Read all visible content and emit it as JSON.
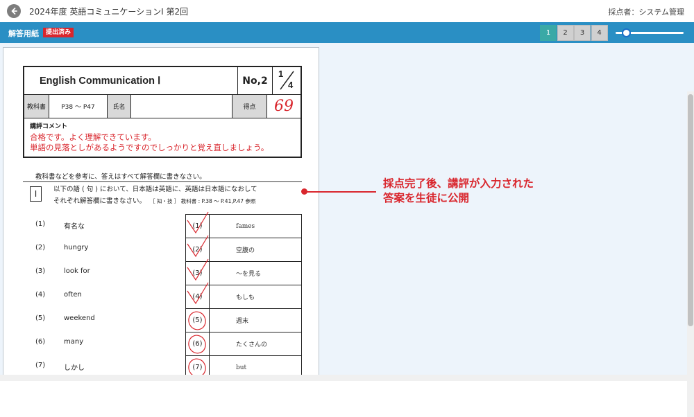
{
  "header": {
    "title": "2024年度 英語コミュニケーションⅠ 第2回",
    "grader": "採点者：システム管理"
  },
  "toolbar": {
    "sheet_label": "解答用紙",
    "status_badge": "提出済み",
    "pages": [
      "1",
      "2",
      "3",
      "4"
    ],
    "active_page": "1",
    "zoom_level": 0.15
  },
  "paper": {
    "course_name": "English Communication Ⅰ",
    "number": "No,2",
    "fraction_num": "1",
    "fraction_den": "4",
    "textbook_label": "教科書",
    "textbook_range": "P38 ～ P47",
    "name_label": "氏名",
    "name_value": "",
    "score_label": "得点",
    "score_value": "69",
    "comment_label": "講評コメント",
    "comment_lines": [
      "合格です。よく理解できています。",
      "単語の見落としがあるようですのでしっかりと覚え直しましょう。"
    ],
    "instruction": "教科書などを参考に、答えはすべて解答欄に書きなさい。",
    "section_number": "Ⅰ",
    "question_line1": "以下の語 ( 句 ) において、日本語は英語に、英語は日本語になおして",
    "question_line2": "それぞれ解答欄に書きなさい。",
    "question_ref": "［ 知・技 ］ 教科書 : P.38 ～ P.41,P.47 参照",
    "questions": [
      {
        "num": "(1)",
        "word": "有名な",
        "ans_num": "(1)",
        "answer": "fames",
        "mark": "wrong"
      },
      {
        "num": "(2)",
        "word": "hungry",
        "ans_num": "(2)",
        "answer": "空腹の",
        "mark": "wrong"
      },
      {
        "num": "(3)",
        "word": "look for",
        "ans_num": "(3)",
        "answer": "～を見る",
        "mark": "wrong"
      },
      {
        "num": "(4)",
        "word": "often",
        "ans_num": "(4)",
        "answer": "もしも",
        "mark": "wrong"
      },
      {
        "num": "(5)",
        "word": "weekend",
        "ans_num": "(5)",
        "answer": "週末",
        "mark": "correct"
      },
      {
        "num": "(6)",
        "word": "many",
        "ans_num": "(6)",
        "answer": "たくさんの",
        "mark": "correct"
      },
      {
        "num": "(7)",
        "word": "しかし",
        "ans_num": "(7)",
        "answer": "but",
        "mark": "correct"
      }
    ]
  },
  "callout": {
    "line1": "採点完了後、講評が入力された",
    "line2": "答案を生徒に公開"
  },
  "colors": {
    "toolbar_blue": "#2a8fc4",
    "badge_red": "#d9262d",
    "active_page": "#3aa9a6",
    "viewer_bg": "#edf4fb"
  }
}
